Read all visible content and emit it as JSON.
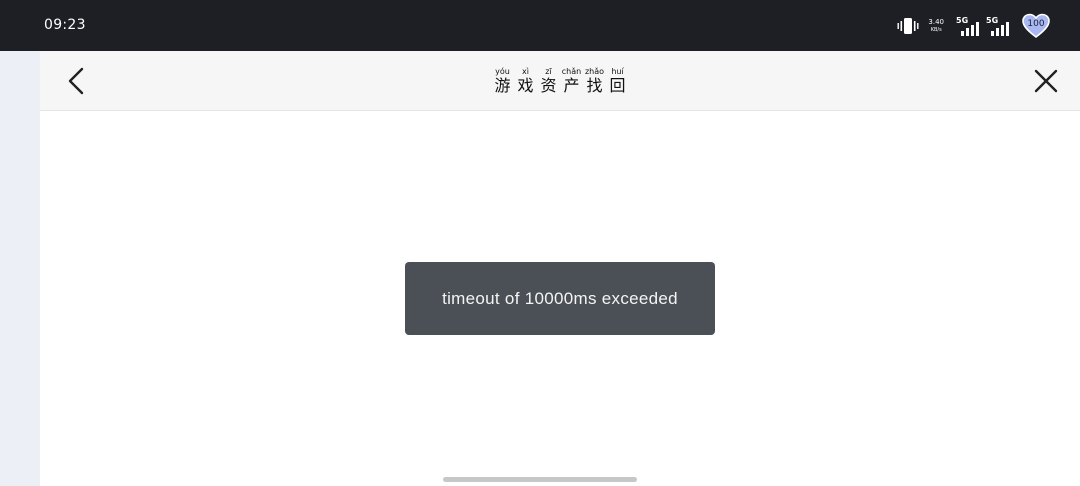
{
  "status_bar": {
    "time": "09:23",
    "network_speed": "3.40",
    "network_speed_unit": "KB/s",
    "sim1_label": "5G",
    "sim2_label": "5G",
    "battery_level": "100",
    "icons": [
      "vibrate-icon",
      "signal-icon",
      "signal-icon",
      "battery-icon"
    ]
  },
  "nav": {
    "title_chars": [
      {
        "pinyin": "yóu",
        "hanzi": "游"
      },
      {
        "pinyin": "xì",
        "hanzi": "戏"
      },
      {
        "pinyin": "zī",
        "hanzi": "资"
      },
      {
        "pinyin": "chǎn",
        "hanzi": "产"
      },
      {
        "pinyin": "zhǎo",
        "hanzi": "找"
      },
      {
        "pinyin": "huí",
        "hanzi": "回"
      }
    ],
    "back_icon": "chevron-left-icon",
    "close_icon": "close-icon"
  },
  "toast": {
    "message": "timeout of 10000ms exceeded"
  },
  "colors": {
    "status_bar_bg": "#1d1f24",
    "nav_bg": "#f6f6f6",
    "side_strip_bg": "#eceff6",
    "toast_bg": "#4b4f56",
    "toast_text": "#f4f4f4"
  }
}
